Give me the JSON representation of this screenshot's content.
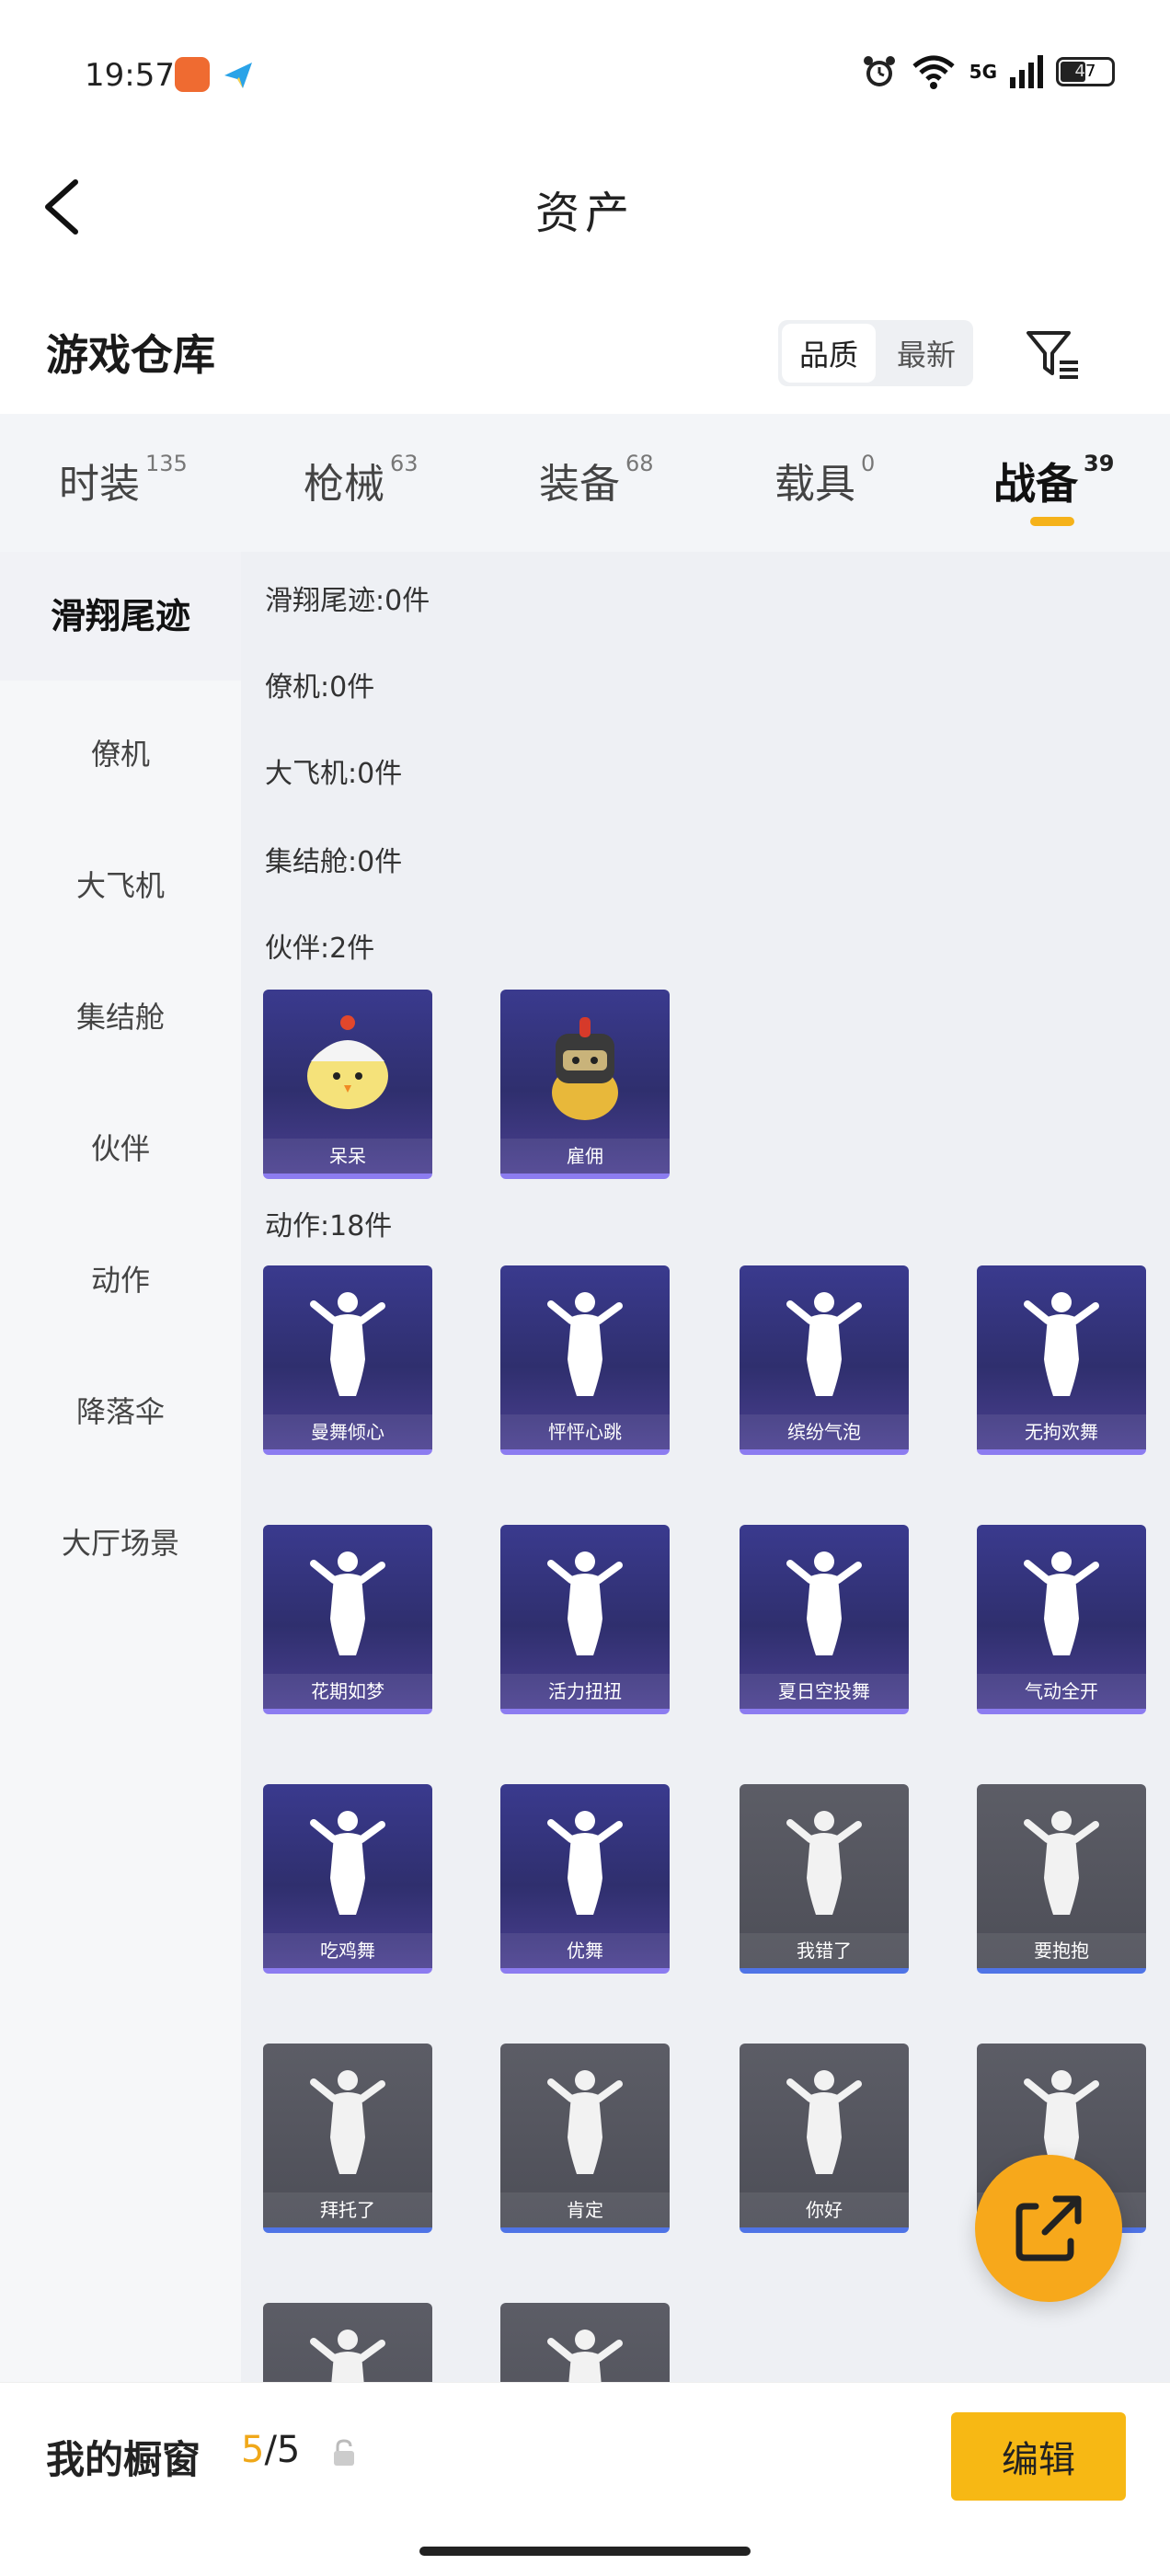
{
  "status_bar": {
    "time": "19:57",
    "network": "5G",
    "battery": "47",
    "icons": [
      "alarm-icon",
      "wifi-icon",
      "signal-icon",
      "battery-icon"
    ]
  },
  "header": {
    "title": "资产",
    "back_icon": "chevron-left-icon"
  },
  "section": {
    "title": "游戏仓库",
    "sort_options": [
      "品质",
      "最新"
    ],
    "active_sort": "品质",
    "filter_icon": "filter-icon"
  },
  "category_tabs": [
    {
      "label": "时装",
      "count": "135"
    },
    {
      "label": "枪械",
      "count": "63"
    },
    {
      "label": "装备",
      "count": "68"
    },
    {
      "label": "载具",
      "count": "0"
    },
    {
      "label": "战备",
      "count": "39"
    }
  ],
  "active_tab": "战备",
  "sidebar": {
    "items": [
      "滑翔尾迹",
      "僚机",
      "大飞机",
      "集结舱",
      "伙伴",
      "动作",
      "降落伞",
      "大厅场景"
    ],
    "active": "滑翔尾迹"
  },
  "groups": [
    {
      "label": "滑翔尾迹:0件"
    },
    {
      "label": "僚机:0件"
    },
    {
      "label": "大飞机:0件"
    },
    {
      "label": "集结舱:0件"
    },
    {
      "label": "伙伴:2件"
    },
    {
      "label": "动作:18件"
    }
  ],
  "partner_items": [
    {
      "name": "呆呆",
      "style": "purple"
    },
    {
      "name": "雇佣",
      "style": "purple"
    }
  ],
  "action_items": [
    {
      "name": "曼舞倾心",
      "style": "purple"
    },
    {
      "name": "怦怦心跳",
      "style": "purple"
    },
    {
      "name": "缤纷气泡",
      "style": "purple"
    },
    {
      "name": "无拘欢舞",
      "style": "purple"
    },
    {
      "name": "花期如梦",
      "style": "purple"
    },
    {
      "name": "活力扭扭",
      "style": "purple"
    },
    {
      "name": "夏日空投舞",
      "style": "purple"
    },
    {
      "name": "气动全开",
      "style": "purple"
    },
    {
      "name": "吃鸡舞",
      "style": "purple"
    },
    {
      "name": "优舞",
      "style": "purple"
    },
    {
      "name": "我错了",
      "style": "gray"
    },
    {
      "name": "要抱抱",
      "style": "gray"
    },
    {
      "name": "拜托了",
      "style": "gray"
    },
    {
      "name": "肯定",
      "style": "gray"
    },
    {
      "name": "你好",
      "style": "gray"
    },
    {
      "name": "",
      "style": "gray"
    },
    {
      "name": "",
      "style": "gray"
    },
    {
      "name": "",
      "style": "gray"
    }
  ],
  "fab_icon": "share-external-icon",
  "bottom_bar": {
    "label": "我的橱窗",
    "count_current": "5",
    "count_total": "/5",
    "lock_icon": "lock-icon",
    "edit_label": "编辑"
  }
}
